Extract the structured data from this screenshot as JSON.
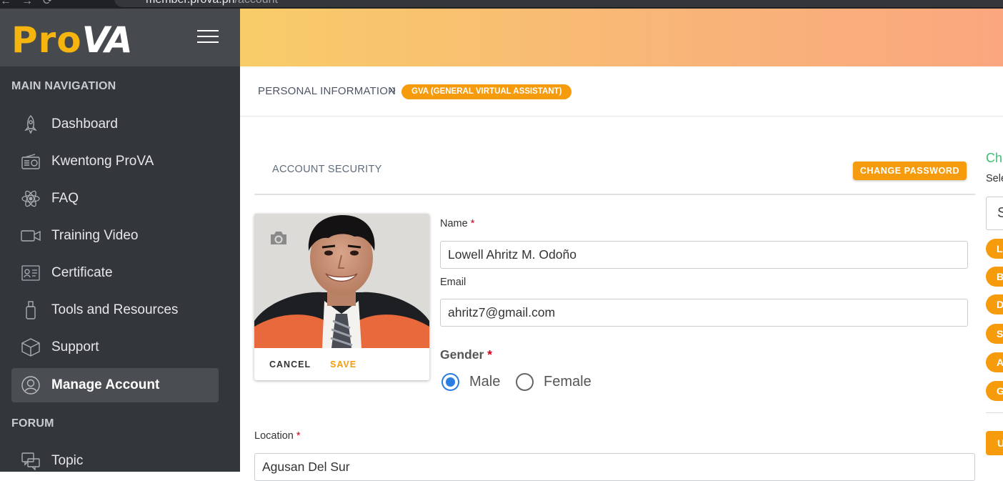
{
  "browser": {
    "url_host": "member.prova.ph",
    "url_path": "/account"
  },
  "sidebar": {
    "logo_main": "Pro",
    "logo_accent": "VA",
    "main_heading": "MAIN NAVIGATION",
    "items": [
      {
        "label": "Dashboard",
        "icon": "rocket-icon"
      },
      {
        "label": "Kwentong ProVA",
        "icon": "radio-icon"
      },
      {
        "label": "FAQ",
        "icon": "atom-icon"
      },
      {
        "label": "Training Video",
        "icon": "video-camera-icon"
      },
      {
        "label": "Certificate",
        "icon": "certificate-icon"
      },
      {
        "label": "Tools and Resources",
        "icon": "usb-drive-icon"
      },
      {
        "label": "Support",
        "icon": "box-icon"
      },
      {
        "label": "Manage Account",
        "icon": "user-circle-icon",
        "active": true
      }
    ],
    "forum_heading": "FORUM",
    "forum_items": [
      {
        "label": "Topic",
        "icon": "chat-bubbles-icon"
      }
    ]
  },
  "breadcrumb": {
    "title": "PERSONAL INFORMATION",
    "separator": "»",
    "badge": "GVA (GENERAL VIRTUAL ASSISTANT)"
  },
  "account": {
    "section_title": "ACCOUNT SECURITY",
    "change_password": "CHANGE PASSWORD",
    "photo_cancel": "CANCEL",
    "photo_save": "SAVE",
    "name_label": "Name",
    "name_value": "Lowell Ahritz M. Odoño",
    "email_label": "Email",
    "email_value": "ahritz7@gmail.com",
    "gender_label": "Gender",
    "gender_options": [
      "Male",
      "Female"
    ],
    "gender_selected": "Male",
    "location_label": "Location",
    "location_value": "Agusan Del Sur",
    "required_mark": "*"
  },
  "right_panel": {
    "title": "Ch",
    "subtitle": "Sele",
    "select_value": "S",
    "chips": [
      "L",
      "B",
      "D",
      "S",
      "A",
      "G"
    ],
    "button": "U"
  },
  "colors": {
    "accent": "#f59b0c",
    "sidebar": "#33363b",
    "selected_radio": "#2a7de1",
    "green": "#3fbf72"
  }
}
